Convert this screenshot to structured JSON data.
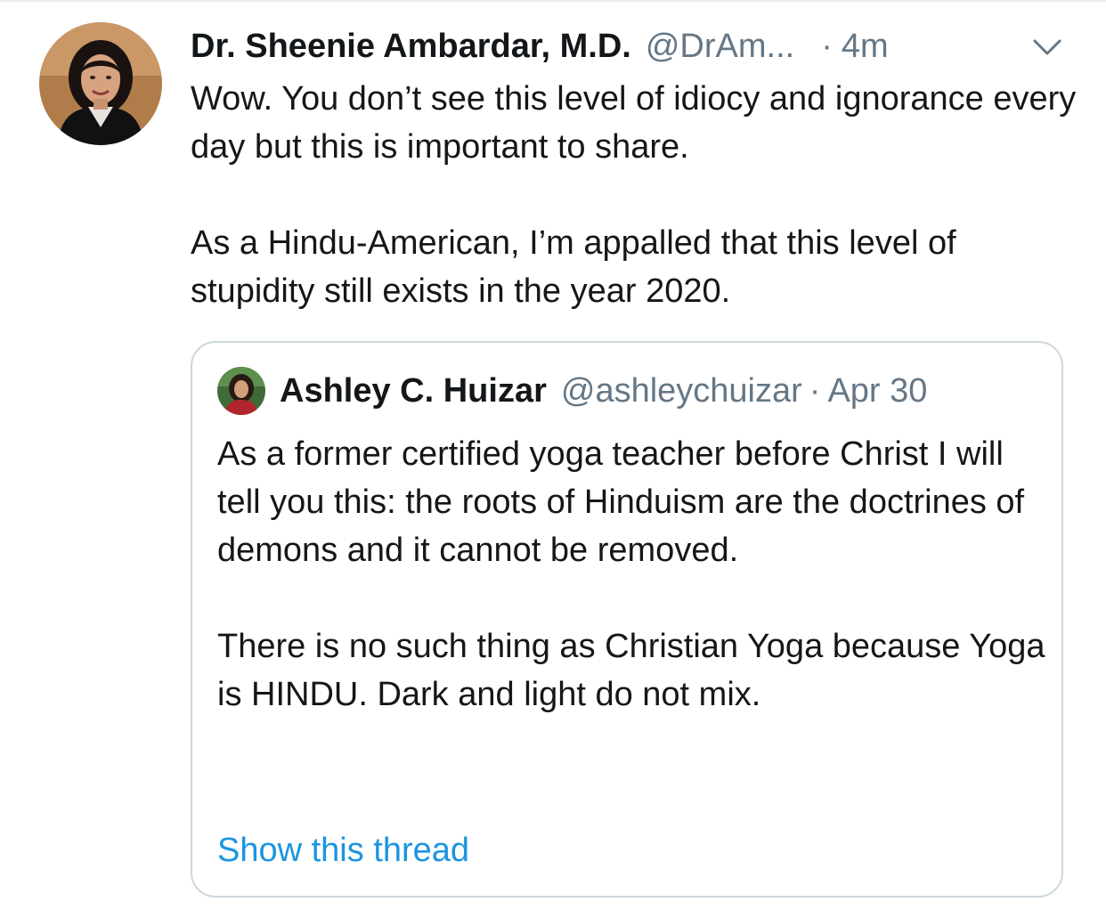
{
  "tweet": {
    "author_name": "Dr. Sheenie Ambardar, M.D.",
    "author_handle": "@DrAm...",
    "separator": "·",
    "time_ago": "4m",
    "menu_icon": "chevron-down-icon",
    "paragraphs": [
      "Wow. You don’t see this level of idiocy and ignorance every day but this is important to share.",
      "As a Hindu-American, I’m appalled that this level of stupidity still exists in the year 2020."
    ]
  },
  "quoted_tweet": {
    "author_name": "Ashley C. Huizar",
    "author_handle": "@ashleychuizar",
    "separator": "·",
    "date": "Apr 30",
    "paragraphs": [
      "As a former certified yoga teacher before Christ I will tell you this: the roots of Hinduism are the doctrines of demons and it cannot be removed.",
      "There is no such thing as Christian Yoga because Yoga is HINDU. Dark and light do not mix."
    ],
    "show_thread_label": "Show this thread"
  },
  "colors": {
    "text_primary": "#14171a",
    "text_secondary": "#657786",
    "link": "#1b95e0",
    "card_border": "#ccd6dd"
  }
}
